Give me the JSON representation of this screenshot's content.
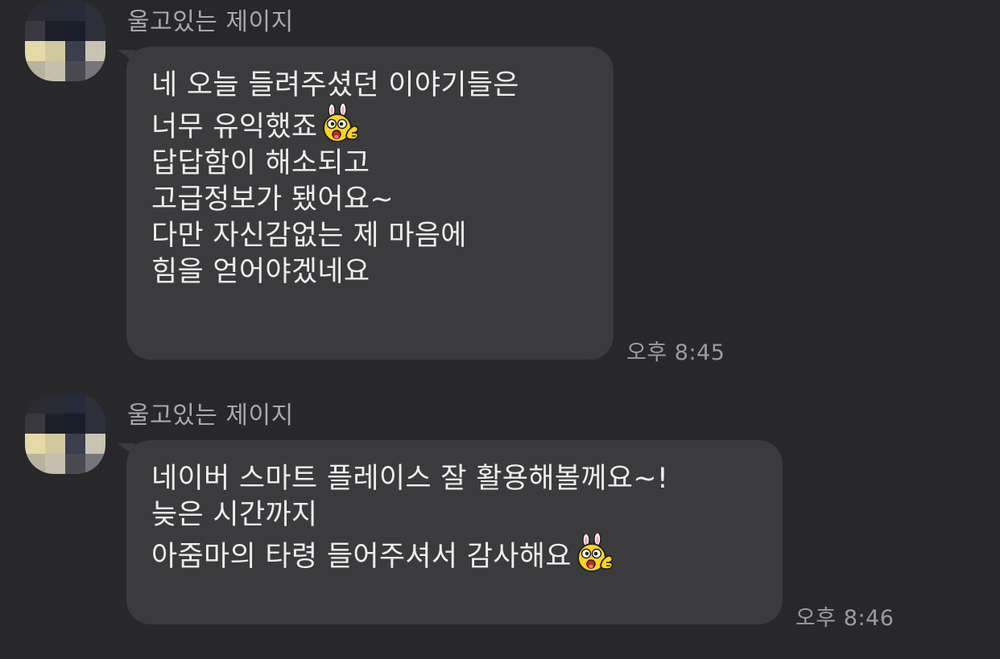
{
  "messages": [
    {
      "sender": "울고있는 제이지",
      "lines": [
        "네 오늘 들려주셨던 이야기들은",
        "너무 유익했죠",
        "답답함이 해소되고",
        "고급정보가 됐어요~",
        "다만 자신감없는 제 마음에",
        "힘을 얻어야겠네요"
      ],
      "time": "오후 8:45",
      "emoticon": "thumbs-up-rabbit-emoticon"
    },
    {
      "sender": "울고있는 제이지",
      "lines": [
        "네이버 스마트 플레이스 잘 활용해볼께요~!",
        "늦은 시간까지",
        "아줌마의 타령 들어주셔서 감사해요"
      ],
      "time": "오후 8:46",
      "emoticon": "thumbs-up-rabbit-emoticon"
    }
  ],
  "colors": {
    "background": "#28282b",
    "bubble": "#3b3b3e",
    "text": "#ededed",
    "sender": "#a9a9ad",
    "timestamp": "#9c9ca0"
  },
  "avatar": {
    "description_icon": "pixelated-avatar",
    "blurred": true
  }
}
